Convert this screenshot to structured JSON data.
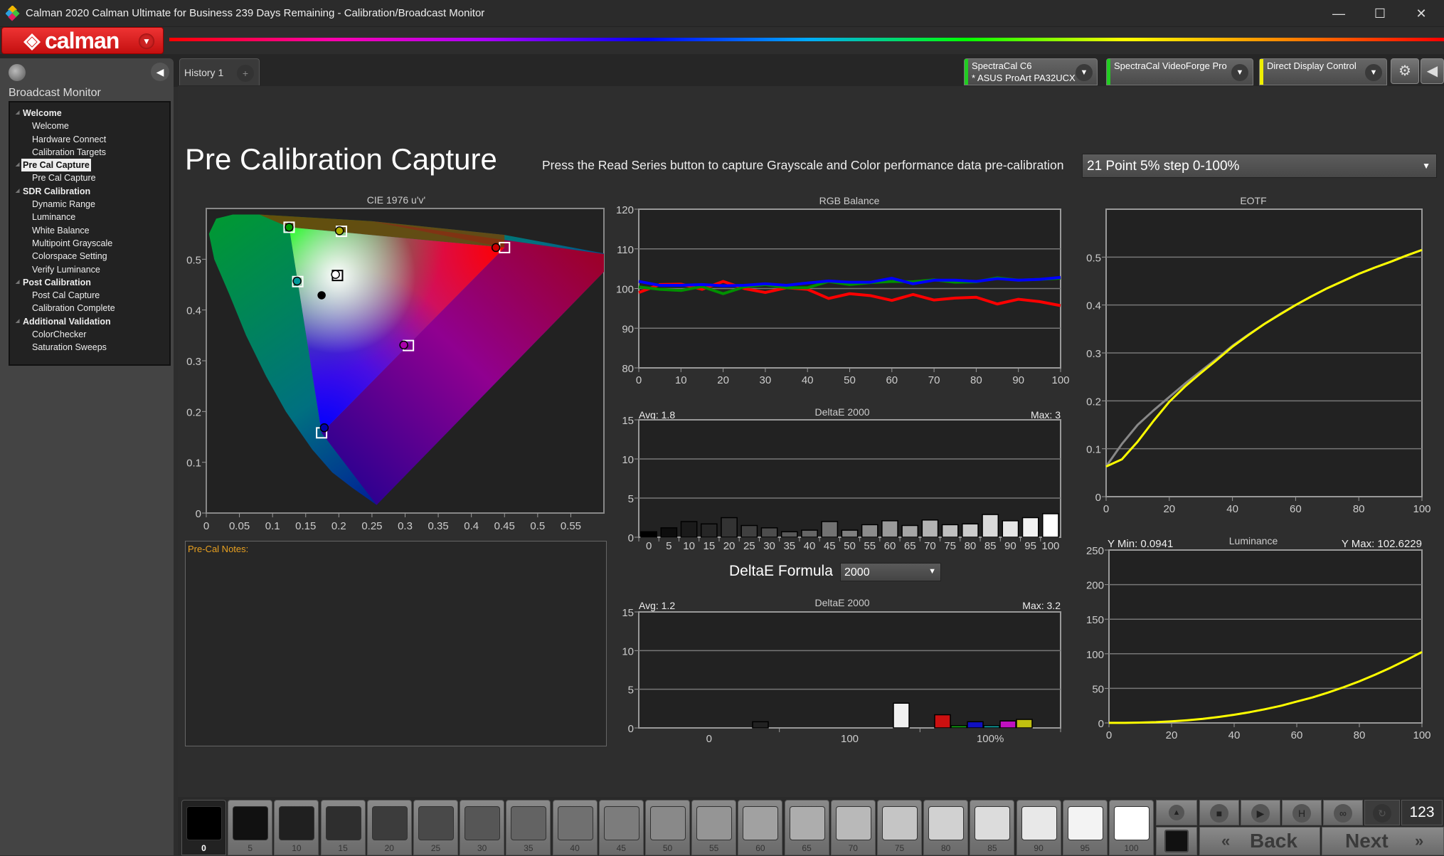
{
  "window": {
    "title": "Calman 2020 Calman Ultimate for Business 239 Days Remaining  -  Calibration/Broadcast Monitor",
    "minimize": "—",
    "maximize": "☐",
    "close": "✕"
  },
  "brand": {
    "name": "calman",
    "accent": "#d42020"
  },
  "sidebar": {
    "heading": "Broadcast Monitor",
    "tree": [
      {
        "label": "Welcome",
        "group": true
      },
      {
        "label": "Welcome"
      },
      {
        "label": "Hardware Connect"
      },
      {
        "label": "Calibration Targets"
      },
      {
        "label": "Pre Cal Capture",
        "group": true,
        "selected": true
      },
      {
        "label": "Pre Cal Capture"
      },
      {
        "label": "SDR Calibration",
        "group": true
      },
      {
        "label": "Dynamic Range"
      },
      {
        "label": "Luminance"
      },
      {
        "label": "White Balance"
      },
      {
        "label": "Multipoint Grayscale"
      },
      {
        "label": "Colorspace Setting"
      },
      {
        "label": "Verify Luminance"
      },
      {
        "label": "Post Calibration",
        "group": true
      },
      {
        "label": "Post Cal Capture"
      },
      {
        "label": "Calibration Complete"
      },
      {
        "label": "Additional Validation",
        "group": true
      },
      {
        "label": "ColorChecker"
      },
      {
        "label": "Saturation Sweeps"
      }
    ]
  },
  "tabs": [
    {
      "label": "History 1"
    }
  ],
  "add_tab": "+",
  "devices": [
    {
      "line1": "SpectraCal C6",
      "line2": "* ASUS ProArt PA32UCX",
      "status_color": "#22cc22"
    },
    {
      "line1": "SpectraCal VideoForge Pro",
      "line2": "",
      "status_color": "#22cc22"
    },
    {
      "line1": "Direct Display Control",
      "line2": "",
      "status_color": "#eeee00"
    }
  ],
  "page": {
    "title": "Pre Calibration Capture",
    "instruction": "Press the Read Series button to capture Grayscale and Color performance data pre-calibration",
    "sequence": "21 Point 5% step 0-100%"
  },
  "notes": {
    "label": "Pre-Cal Notes:",
    "value": ""
  },
  "deltae_formula": {
    "label": "DeltaE Formula",
    "value": "2000"
  },
  "chart_data": [
    {
      "type": "scatter",
      "title": "CIE 1976 u'v'",
      "xlim": [
        0,
        0.6
      ],
      "ylim": [
        0,
        0.6
      ],
      "xticks": [
        "0",
        "0.05",
        "0.1",
        "0.15",
        "0.2",
        "0.25",
        "0.3",
        "0.35",
        "0.4",
        "0.45",
        "0.5",
        "0.55"
      ],
      "yticks": [
        "0",
        "0.1",
        "0.2",
        "0.3",
        "0.4",
        "0.5"
      ],
      "targets": [
        {
          "name": "Red",
          "u": 0.45,
          "v": 0.523,
          "color": "#ff0000"
        },
        {
          "name": "Green",
          "u": 0.125,
          "v": 0.563,
          "color": "#00c000"
        },
        {
          "name": "Blue",
          "u": 0.174,
          "v": 0.158,
          "color": "#0000ff"
        },
        {
          "name": "Cyan",
          "u": 0.138,
          "v": 0.456,
          "color": "#00c0c0"
        },
        {
          "name": "Magenta",
          "u": 0.305,
          "v": 0.33,
          "color": "#ff00ff"
        },
        {
          "name": "Yellow",
          "u": 0.204,
          "v": 0.555,
          "color": "#e0e000"
        },
        {
          "name": "White",
          "u": 0.198,
          "v": 0.468,
          "color": "#ffffff"
        }
      ],
      "measured": [
        {
          "name": "Red",
          "u": 0.437,
          "v": 0.523,
          "color": "#cc0000"
        },
        {
          "name": "Green",
          "u": 0.125,
          "v": 0.563,
          "color": "#009900"
        },
        {
          "name": "Blue",
          "u": 0.178,
          "v": 0.168,
          "color": "#0000aa"
        },
        {
          "name": "Cyan",
          "u": 0.137,
          "v": 0.457,
          "color": "#009999"
        },
        {
          "name": "Magenta",
          "u": 0.298,
          "v": 0.331,
          "color": "#aa00aa"
        },
        {
          "name": "Yellow",
          "u": 0.201,
          "v": 0.556,
          "color": "#aaaa00"
        },
        {
          "name": "White",
          "u": 0.195,
          "v": 0.47,
          "color": "#ffffff"
        },
        {
          "name": "Black",
          "u": 0.174,
          "v": 0.429,
          "color": "#000000"
        }
      ]
    },
    {
      "type": "line",
      "title": "RGB Balance",
      "xlim": [
        0,
        100
      ],
      "ylim": [
        80,
        120
      ],
      "xticks": [
        "0",
        "10",
        "20",
        "30",
        "40",
        "50",
        "60",
        "70",
        "80",
        "90",
        "100"
      ],
      "yticks": [
        "80",
        "90",
        "100",
        "110",
        "120"
      ],
      "x": [
        0,
        5,
        10,
        15,
        20,
        25,
        30,
        35,
        40,
        45,
        50,
        55,
        60,
        65,
        70,
        75,
        80,
        85,
        90,
        95,
        100
      ],
      "series": [
        {
          "color": "#ff0000",
          "values": [
            99.0,
            101.0,
            101.1,
            99.8,
            101.8,
            100.0,
            99.0,
            100.2,
            99.8,
            97.5,
            98.7,
            98.2,
            97.0,
            98.5,
            97.1,
            97.6,
            97.8,
            96.1,
            97.3,
            96.7,
            95.7
          ]
        },
        {
          "color": "#009000",
          "values": [
            100.4,
            99.8,
            99.5,
            100.5,
            98.7,
            100.4,
            101.0,
            100.2,
            100.2,
            101.8,
            101.0,
            101.5,
            101.8,
            101.7,
            102.2,
            101.6,
            101.7,
            102.7,
            102.1,
            102.3,
            102.6
          ]
        },
        {
          "color": "#0000ff",
          "values": [
            101.8,
            100.8,
            100.8,
            101.0,
            100.7,
            100.8,
            101.2,
            100.8,
            101.4,
            101.9,
            101.6,
            101.6,
            102.6,
            101.2,
            102.1,
            102.1,
            101.8,
            102.5,
            102.1,
            102.3,
            102.8
          ]
        }
      ]
    },
    {
      "type": "bar",
      "title": "DeltaE 2000",
      "avg": "Avg: 1.8",
      "max": "Max: 3",
      "ylim": [
        0,
        15
      ],
      "yticks": [
        "0",
        "5",
        "10",
        "15"
      ],
      "categories": [
        "0",
        "5",
        "10",
        "15",
        "20",
        "25",
        "30",
        "35",
        "40",
        "45",
        "50",
        "55",
        "60",
        "65",
        "70",
        "75",
        "80",
        "85",
        "90",
        "95",
        "100"
      ],
      "values": [
        0.7,
        1.2,
        2.0,
        1.7,
        2.5,
        1.5,
        1.2,
        0.7,
        0.9,
        2.0,
        0.9,
        1.6,
        2.1,
        1.5,
        2.2,
        1.6,
        1.7,
        2.9,
        2.1,
        2.5,
        3.0
      ]
    },
    {
      "type": "bar",
      "title": "DeltaE 2000",
      "avg": "Avg: 1.2",
      "max": "Max: 3.2",
      "ylim": [
        0,
        15
      ],
      "yticks": [
        "0",
        "5",
        "10",
        "15"
      ],
      "categories": [
        "0",
        "100",
        "100%"
      ],
      "bars": [
        {
          "group": "0",
          "name": "Black",
          "value": 0.8,
          "color": "#222222"
        },
        {
          "group": "100",
          "name": "White",
          "value": 3.2,
          "color": "#f0f0f0"
        },
        {
          "group": "100%",
          "name": "Red",
          "value": 1.7,
          "color": "#cc1010"
        },
        {
          "group": "100%",
          "name": "Green",
          "value": 0.3,
          "color": "#10a010"
        },
        {
          "group": "100%",
          "name": "Blue",
          "value": 0.8,
          "color": "#1010c0"
        },
        {
          "group": "100%",
          "name": "Cyan",
          "value": 0.3,
          "color": "#10a0a0"
        },
        {
          "group": "100%",
          "name": "Magenta",
          "value": 0.9,
          "color": "#c010c0"
        },
        {
          "group": "100%",
          "name": "Yellow",
          "value": 1.1,
          "color": "#c0c010"
        }
      ]
    },
    {
      "type": "line",
      "title": "EOTF",
      "xlim": [
        0,
        100
      ],
      "ylim": [
        0,
        0.6
      ],
      "xticks": [
        "0",
        "20",
        "40",
        "60",
        "80",
        "100"
      ],
      "yticks": [
        "0",
        "0.1",
        "0.2",
        "0.3",
        "0.4",
        "0.5"
      ],
      "x": [
        0,
        5,
        10,
        15,
        20,
        25,
        30,
        35,
        40,
        45,
        50,
        55,
        60,
        65,
        70,
        75,
        80,
        85,
        90,
        95,
        100
      ],
      "series": [
        {
          "color": "#888888",
          "values": [
            0.063,
            0.11,
            0.15,
            0.18,
            0.208,
            0.236,
            0.262,
            0.288,
            0.315,
            0.338,
            0.36,
            0.381,
            0.4,
            0.418,
            0.435,
            0.45,
            0.465,
            0.478,
            0.49,
            0.503,
            0.515
          ]
        },
        {
          "color": "#ffff00",
          "values": [
            0.063,
            0.078,
            0.115,
            0.158,
            0.198,
            0.23,
            0.258,
            0.285,
            0.313,
            0.337,
            0.36,
            0.38,
            0.4,
            0.418,
            0.435,
            0.45,
            0.465,
            0.478,
            0.49,
            0.503,
            0.515
          ]
        }
      ]
    },
    {
      "type": "line",
      "title": "Luminance",
      "ymin_label": "Y Min: 0.0941",
      "ymax_label": "Y Max: 102.6229",
      "xlim": [
        0,
        100
      ],
      "ylim": [
        0,
        250
      ],
      "xticks": [
        "0",
        "20",
        "40",
        "60",
        "80",
        "100"
      ],
      "yticks": [
        "0",
        "50",
        "100",
        "150",
        "200",
        "250"
      ],
      "x": [
        0,
        5,
        10,
        15,
        20,
        25,
        30,
        35,
        40,
        45,
        50,
        55,
        60,
        65,
        70,
        75,
        80,
        85,
        90,
        95,
        100
      ],
      "series": [
        {
          "color": "#ffff00",
          "values": [
            0.09,
            0.1,
            0.5,
            1.1,
            2.3,
            3.9,
            5.9,
            8.6,
            11.8,
            15.6,
            20.0,
            24.9,
            30.9,
            36.8,
            43.9,
            51.7,
            60.2,
            69.7,
            79.9,
            90.9,
            102.6
          ]
        }
      ]
    }
  ],
  "patches": {
    "labels": [
      "0",
      "5",
      "10",
      "15",
      "20",
      "25",
      "30",
      "35",
      "40",
      "45",
      "50",
      "55",
      "60",
      "65",
      "70",
      "75",
      "80",
      "85",
      "90",
      "95",
      "100"
    ],
    "selected": "0"
  },
  "controls": {
    "up": "▲",
    "stop": "■",
    "play": "▶",
    "hold": "H",
    "loop": "∞",
    "refresh": "↻",
    "numeric": "123",
    "back": "Back",
    "next": "Next",
    "back_arrow": "«",
    "next_arrow": "»"
  }
}
